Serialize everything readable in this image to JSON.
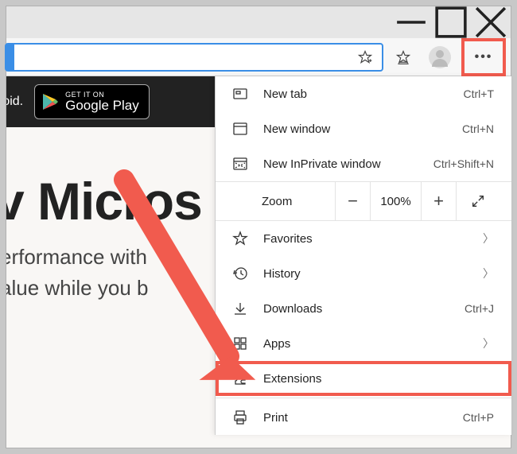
{
  "window_controls": {
    "minimize": "–",
    "maximize": "□",
    "close": "✕"
  },
  "toolbar": {
    "fav_add_icon": "star-plus-icon",
    "favorites_icon": "favorites-bar-icon",
    "profile_icon": "profile-icon",
    "more_icon": "more-icon"
  },
  "promo": {
    "text_fragment": "roid.",
    "store_small": "GET IT ON",
    "store_big": "Google Play"
  },
  "page": {
    "heading_fragment": "Micros",
    "heading_prefix": "v ",
    "sub1": "erformance with",
    "sub2": "alue while you b"
  },
  "menu": {
    "newtab": {
      "label": "New tab",
      "shortcut": "Ctrl+T"
    },
    "newwin": {
      "label": "New window",
      "shortcut": "Ctrl+N"
    },
    "inpriv": {
      "label": "New InPrivate window",
      "shortcut": "Ctrl+Shift+N"
    },
    "zoom": {
      "label": "Zoom",
      "value": "100%",
      "minus": "−",
      "plus": "+"
    },
    "favorites": {
      "label": "Favorites"
    },
    "history": {
      "label": "History"
    },
    "downloads": {
      "label": "Downloads",
      "shortcut": "Ctrl+J"
    },
    "apps": {
      "label": "Apps"
    },
    "extensions": {
      "label": "Extensions"
    },
    "print": {
      "label": "Print",
      "shortcut": "Ctrl+P"
    }
  }
}
